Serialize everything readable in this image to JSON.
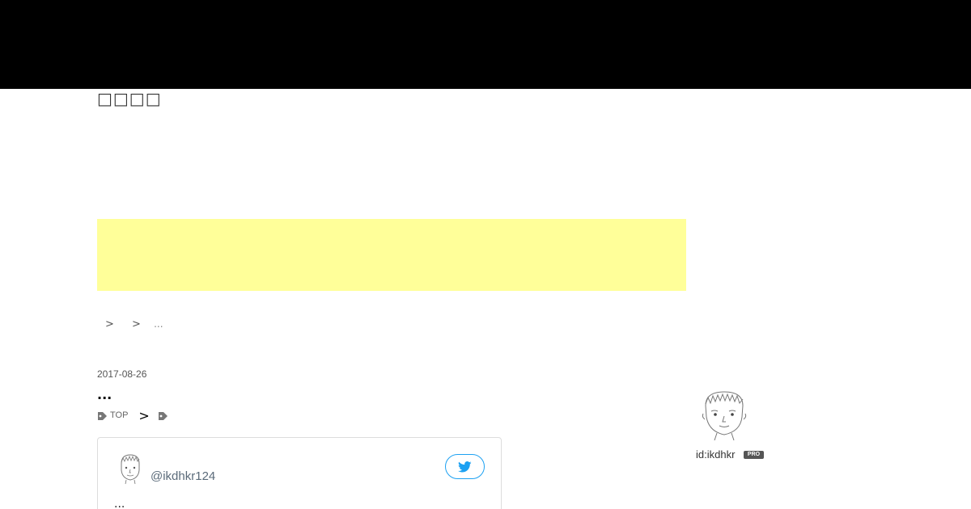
{
  "header": {
    "blog_title": "□□□□"
  },
  "ad": {
    "background_color": "#ffff99"
  },
  "breadcrumb": {
    "separator": ">",
    "current": "..."
  },
  "entry": {
    "date": "2017-08-26",
    "title": "...",
    "categories": [
      {
        "label": "TOP",
        "icon": "tag-icon"
      },
      {
        "label": "",
        "icon": "tag-icon"
      }
    ],
    "category_separator": ">"
  },
  "tweet_card": {
    "handle": "@ikdhkr124",
    "text": "...",
    "button_icon": "twitter-bird-icon",
    "accent_color": "#1da1f2"
  },
  "profile": {
    "id_label": "id:ikdhkr",
    "badge": "PRO"
  }
}
